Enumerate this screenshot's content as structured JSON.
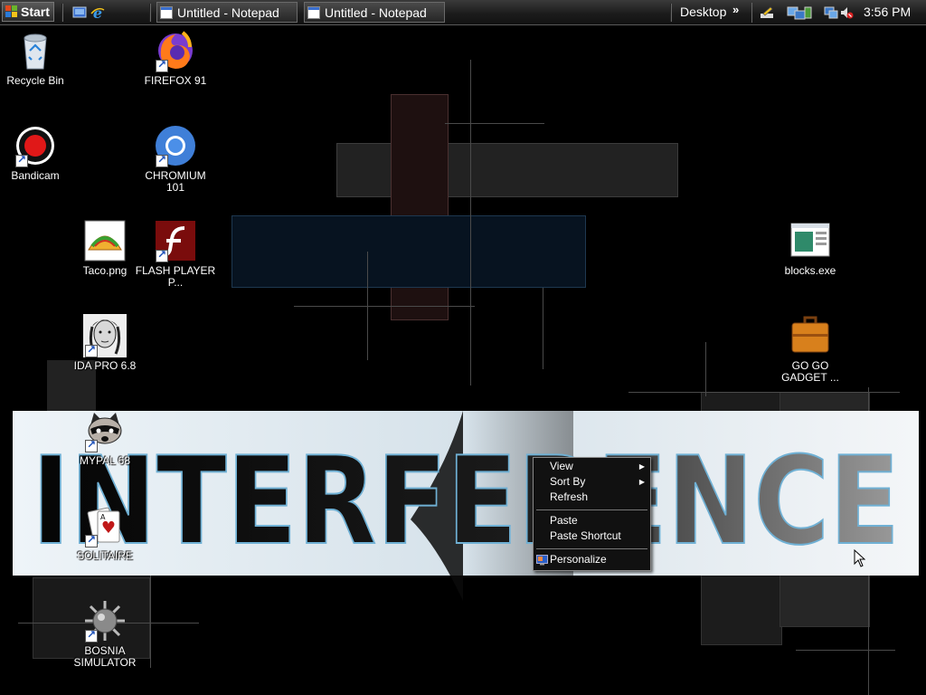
{
  "taskbar": {
    "start_label": "Start",
    "tasks": [
      {
        "label": "Untitled - Notepad"
      },
      {
        "label": "Untitled - Notepad"
      }
    ],
    "toolbar_label": "Desktop",
    "toolbar_chevron": "»",
    "clock": "3:56 PM"
  },
  "desktop": {
    "icons": [
      {
        "id": "recycle-bin",
        "label": "Recycle Bin"
      },
      {
        "id": "firefox",
        "label": "FIREFOX 91"
      },
      {
        "id": "bandicam",
        "label": "Bandicam"
      },
      {
        "id": "chromium",
        "label": "CHROMIUM 101"
      },
      {
        "id": "taco",
        "label": "Taco.png"
      },
      {
        "id": "flash",
        "label": "FLASH PLAYER P..."
      },
      {
        "id": "blocks",
        "label": "blocks.exe"
      },
      {
        "id": "ida-pro",
        "label": "IDA PRO 6.8"
      },
      {
        "id": "go-go-gadget",
        "label": "GO GO GADGET ..."
      },
      {
        "id": "mypal",
        "label": "MYPAL 68"
      },
      {
        "id": "solitaire",
        "label": "SOLITAIRE"
      },
      {
        "id": "bosnia-simulator",
        "label": "BOSNIA SIMULATOR"
      }
    ]
  },
  "wallpaper": {
    "banner_text": "INTERFERENCE"
  },
  "context_menu": {
    "items": [
      {
        "label": "View",
        "submenu": true
      },
      {
        "label": "Sort By",
        "submenu": true
      },
      {
        "label": "Refresh",
        "submenu": false
      },
      {
        "label": "Paste",
        "submenu": false
      },
      {
        "label": "Paste Shortcut",
        "submenu": false
      },
      {
        "label": "Personalize",
        "submenu": false
      }
    ]
  },
  "icons_semantic": {
    "start": "windows-logo-icon",
    "quicklaunch": [
      "show-desktop-icon",
      "internet-explorer-icon"
    ],
    "tray": [
      "pen-tablet-icon",
      "network-icon",
      "display-icon",
      "volume-icon"
    ],
    "cursor": "mouse-pointer-icon"
  }
}
